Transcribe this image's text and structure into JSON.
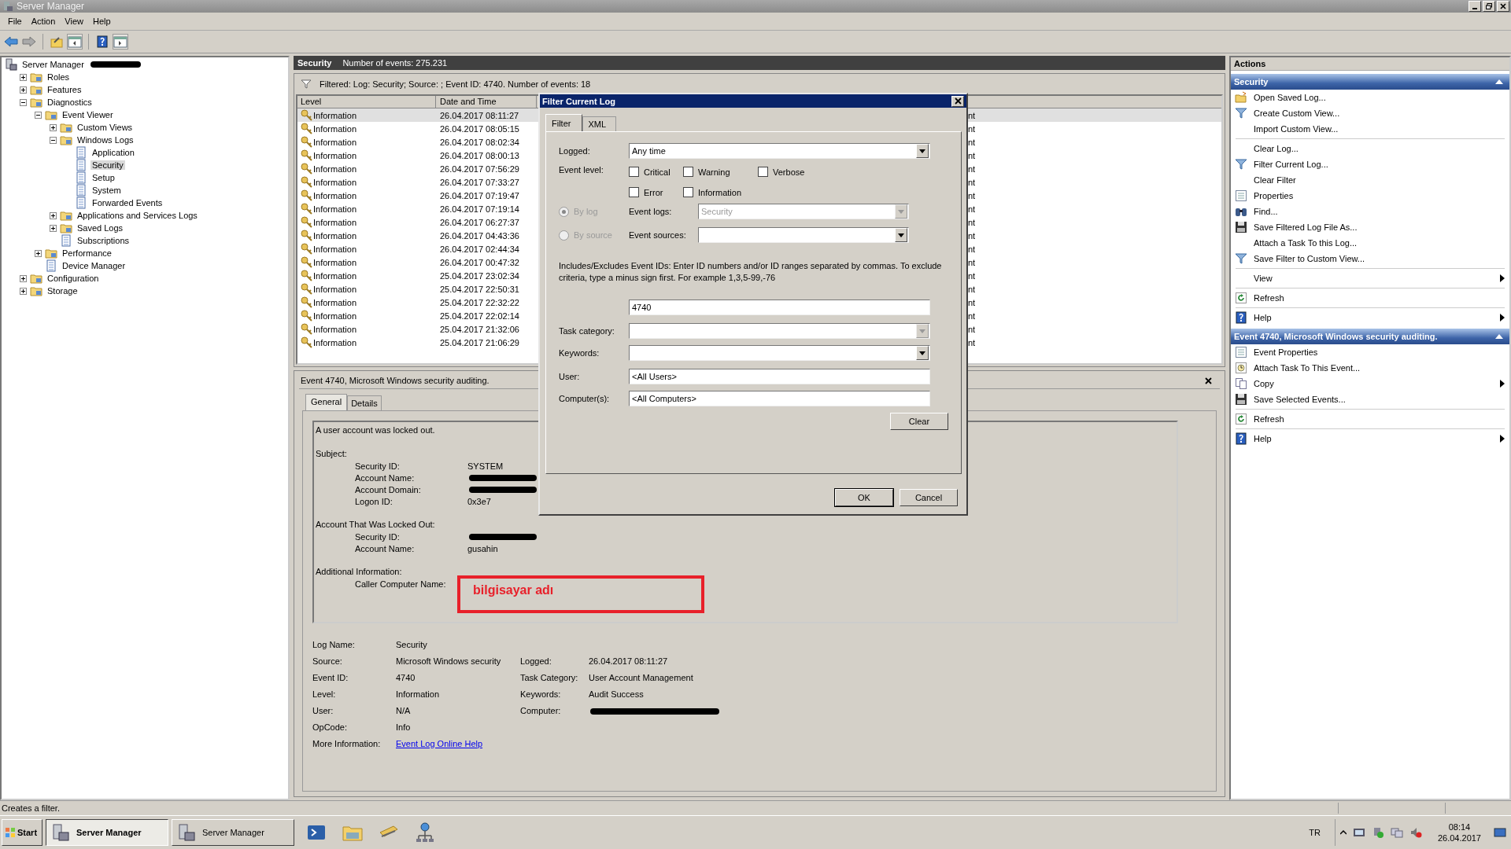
{
  "window": {
    "title": "Server Manager"
  },
  "menu": [
    "File",
    "Action",
    "View",
    "Help"
  ],
  "tree": [
    {
      "label": "Server Manager",
      "kind": "root",
      "selected": false,
      "redacted": true,
      "children": [
        {
          "label": "Roles",
          "kind": "node",
          "expanded": false,
          "selected": false
        },
        {
          "label": "Features",
          "kind": "node",
          "expanded": false,
          "selected": false
        },
        {
          "label": "Diagnostics",
          "kind": "node",
          "expanded": true,
          "selected": false,
          "children": [
            {
              "label": "Event Viewer",
              "kind": "node",
              "expanded": true,
              "selected": false,
              "children": [
                {
                  "label": "Custom Views",
                  "kind": "node",
                  "expanded": false,
                  "selected": false
                },
                {
                  "label": "Windows Logs",
                  "kind": "node",
                  "expanded": true,
                  "selected": false,
                  "children": [
                    {
                      "label": "Application",
                      "kind": "leaf",
                      "selected": false
                    },
                    {
                      "label": "Security",
                      "kind": "leaf",
                      "selected": true
                    },
                    {
                      "label": "Setup",
                      "kind": "leaf",
                      "selected": false
                    },
                    {
                      "label": "System",
                      "kind": "leaf",
                      "selected": false
                    },
                    {
                      "label": "Forwarded Events",
                      "kind": "leaf",
                      "selected": false
                    }
                  ]
                },
                {
                  "label": "Applications and Services Logs",
                  "kind": "node",
                  "expanded": false,
                  "selected": false
                },
                {
                  "label": "Saved Logs",
                  "kind": "node",
                  "expanded": false,
                  "selected": false
                },
                {
                  "label": "Subscriptions",
                  "kind": "leaf",
                  "selected": false
                }
              ]
            },
            {
              "label": "Performance",
              "kind": "node",
              "expanded": false,
              "selected": false
            },
            {
              "label": "Device Manager",
              "kind": "leaf",
              "selected": false
            }
          ]
        },
        {
          "label": "Configuration",
          "kind": "node",
          "expanded": false,
          "selected": false
        },
        {
          "label": "Storage",
          "kind": "node",
          "expanded": false,
          "selected": false
        }
      ]
    }
  ],
  "log_header": {
    "title": "Security",
    "count": "Number of events: 275.231"
  },
  "filter_bar": "Filtered: Log: Security; Source: ; Event ID: 4740. Number of events: 18",
  "events": {
    "columns": [
      "Level",
      "Date and Time"
    ],
    "rows": [
      {
        "level": "Information",
        "date": "26.04.2017 08:11:27",
        "column_3": "nt",
        "selected": true
      },
      {
        "level": "Information",
        "date": "26.04.2017 08:05:15",
        "column_3": "nt",
        "selected": false
      },
      {
        "level": "Information",
        "date": "26.04.2017 08:02:34",
        "column_3": "nt",
        "selected": false
      },
      {
        "level": "Information",
        "date": "26.04.2017 08:00:13",
        "column_3": "nt",
        "selected": false
      },
      {
        "level": "Information",
        "date": "26.04.2017 07:56:29",
        "column_3": "nt",
        "selected": false
      },
      {
        "level": "Information",
        "date": "26.04.2017 07:33:27",
        "column_3": "nt",
        "selected": false
      },
      {
        "level": "Information",
        "date": "26.04.2017 07:19:47",
        "column_3": "nt",
        "selected": false
      },
      {
        "level": "Information",
        "date": "26.04.2017 07:19:14",
        "column_3": "nt",
        "selected": false
      },
      {
        "level": "Information",
        "date": "26.04.2017 06:27:37",
        "column_3": "nt",
        "selected": false
      },
      {
        "level": "Information",
        "date": "26.04.2017 04:43:36",
        "column_3": "nt",
        "selected": false
      },
      {
        "level": "Information",
        "date": "26.04.2017 02:44:34",
        "column_3": "nt",
        "selected": false
      },
      {
        "level": "Information",
        "date": "26.04.2017 00:47:32",
        "column_3": "nt",
        "selected": false
      },
      {
        "level": "Information",
        "date": "25.04.2017 23:02:34",
        "column_3": "nt",
        "selected": false
      },
      {
        "level": "Information",
        "date": "25.04.2017 22:50:31",
        "column_3": "nt",
        "selected": false
      },
      {
        "level": "Information",
        "date": "25.04.2017 22:32:22",
        "column_3": "nt",
        "selected": false
      },
      {
        "level": "Information",
        "date": "25.04.2017 22:02:14",
        "column_3": "nt",
        "selected": false
      },
      {
        "level": "Information",
        "date": "25.04.2017 21:32:06",
        "column_3": "nt",
        "selected": false
      },
      {
        "level": "Information",
        "date": "25.04.2017 21:06:29",
        "column_3": "nt",
        "selected": false
      }
    ]
  },
  "event_detail": {
    "title": "Event 4740, Microsoft Windows security auditing.",
    "tabs": [
      {
        "label": "General",
        "selected": true
      },
      {
        "label": "Details",
        "selected": false
      }
    ],
    "message": "A user account was locked out.",
    "sections": [
      {
        "title": "Subject:",
        "fields": [
          {
            "label": "Security ID:",
            "value": "SYSTEM",
            "redacted": false
          },
          {
            "label": "Account Name:",
            "redacted": true
          },
          {
            "label": "Account Domain:",
            "redacted": true
          },
          {
            "label": "Logon ID:",
            "value": "0x3e7",
            "redacted": false
          }
        ]
      },
      {
        "title": "Account That Was Locked Out:",
        "fields": [
          {
            "label": "Security ID:",
            "redacted": true
          },
          {
            "label": "Account Name:",
            "value": "gusahin",
            "redacted": false
          }
        ]
      },
      {
        "title": "Additional Information:",
        "fields": [
          {
            "label": "Caller Computer Name:",
            "annotation": "bilgisayar adı"
          }
        ]
      }
    ],
    "properties": [
      [
        {
          "label": "Log Name:",
          "value": "Security"
        }
      ],
      [
        {
          "label": "Source:",
          "value": "Microsoft Windows security"
        },
        {
          "label": "Logged:",
          "value": "26.04.2017 08:11:27"
        }
      ],
      [
        {
          "label": "Event ID:",
          "value": "4740"
        },
        {
          "label": "Task Category:",
          "value": "User Account Management"
        }
      ],
      [
        {
          "label": "Level:",
          "value": "Information"
        },
        {
          "label": "Keywords:",
          "value": "Audit Success"
        }
      ],
      [
        {
          "label": "User:",
          "value": "N/A"
        },
        {
          "label": "Computer:",
          "redacted": true
        }
      ],
      [
        {
          "label": "OpCode:",
          "value": "Info"
        }
      ],
      [
        {
          "label": "More Information:",
          "link": "Event Log Online Help"
        }
      ]
    ]
  },
  "filter_dialog": {
    "title": "Filter Current Log",
    "tabs": [
      {
        "label": "Filter",
        "selected": true
      },
      {
        "label": "XML",
        "selected": false
      }
    ],
    "logged": {
      "label": "Logged:",
      "value": "Any time"
    },
    "event_level": {
      "label": "Event level:",
      "options": [
        {
          "label": "Critical",
          "checked": false
        },
        {
          "label": "Warning",
          "checked": false
        },
        {
          "label": "Verbose",
          "checked": false
        },
        {
          "label": "Error",
          "checked": false
        },
        {
          "label": "Information",
          "checked": false
        }
      ]
    },
    "sources": [
      {
        "label": "By log",
        "selected": true,
        "disabled": true,
        "field_label": "Event logs:",
        "value": "Security",
        "field_disabled": true
      },
      {
        "label": "By source",
        "selected": false,
        "disabled": true,
        "field_label": "Event sources:",
        "field_disabled": false
      }
    ],
    "ids_hint": "Includes/Excludes Event IDs: Enter ID numbers and/or ID ranges separated by commas. To exclude criteria, type a minus sign first. For example 1,3,5-99,-76",
    "event_ids": "4740",
    "task_category": {
      "label": "Task category:",
      "disabled": true
    },
    "keywords": {
      "label": "Keywords:",
      "disabled": false
    },
    "user": {
      "label": "User:",
      "value": "<All Users>"
    },
    "computers": {
      "label": "Computer(s):",
      "value": "<All Computers>"
    },
    "clear_button": "Clear",
    "buttons": [
      "OK",
      "Cancel"
    ]
  },
  "actions": {
    "title": "Actions",
    "sections": [
      {
        "title": "Security",
        "expanded": true,
        "groups": [
          [
            {
              "label": "Open Saved Log...",
              "kind": "open",
              "submenu": false
            },
            {
              "label": "Create Custom View...",
              "kind": "filter",
              "submenu": false
            },
            {
              "label": "Import Custom View...",
              "kind": "none",
              "submenu": false
            }
          ],
          [
            {
              "label": "Clear Log...",
              "kind": "none",
              "submenu": false
            },
            {
              "label": "Filter Current Log...",
              "kind": "filter",
              "submenu": false
            },
            {
              "label": "Clear Filter",
              "kind": "none",
              "submenu": false
            },
            {
              "label": "Properties",
              "kind": "properties",
              "submenu": false
            },
            {
              "label": "Find...",
              "kind": "find",
              "submenu": false
            },
            {
              "label": "Save Filtered Log File As...",
              "kind": "save",
              "submenu": false
            },
            {
              "label": "Attach a Task To this Log...",
              "kind": "none",
              "submenu": false
            },
            {
              "label": "Save Filter to Custom View...",
              "kind": "filter",
              "submenu": false
            }
          ],
          [
            {
              "label": "View",
              "kind": "none",
              "submenu": true
            }
          ],
          [
            {
              "label": "Refresh",
              "kind": "refresh",
              "submenu": false
            }
          ],
          [
            {
              "label": "Help",
              "kind": "help",
              "submenu": true
            }
          ]
        ]
      },
      {
        "title": "Event 4740, Microsoft Windows security auditing.",
        "expanded": true,
        "groups": [
          [
            {
              "label": "Event Properties",
              "kind": "properties",
              "submenu": false
            },
            {
              "label": "Attach Task To This Event...",
              "kind": "task",
              "submenu": false
            },
            {
              "label": "Copy",
              "kind": "copy",
              "submenu": true
            },
            {
              "label": "Save Selected Events...",
              "kind": "save",
              "submenu": false
            }
          ],
          [
            {
              "label": "Refresh",
              "kind": "refresh",
              "submenu": false
            }
          ],
          [
            {
              "label": "Help",
              "kind": "help",
              "submenu": true
            }
          ]
        ]
      }
    ]
  },
  "status_bar": "Creates a filter.",
  "taskbar": {
    "start": "Start",
    "tasks": [
      {
        "label": "Server Manager",
        "selected": true
      },
      {
        "label": "Server Manager",
        "selected": false
      }
    ],
    "language": "TR",
    "time": "08:14",
    "date": "26.04.2017"
  }
}
